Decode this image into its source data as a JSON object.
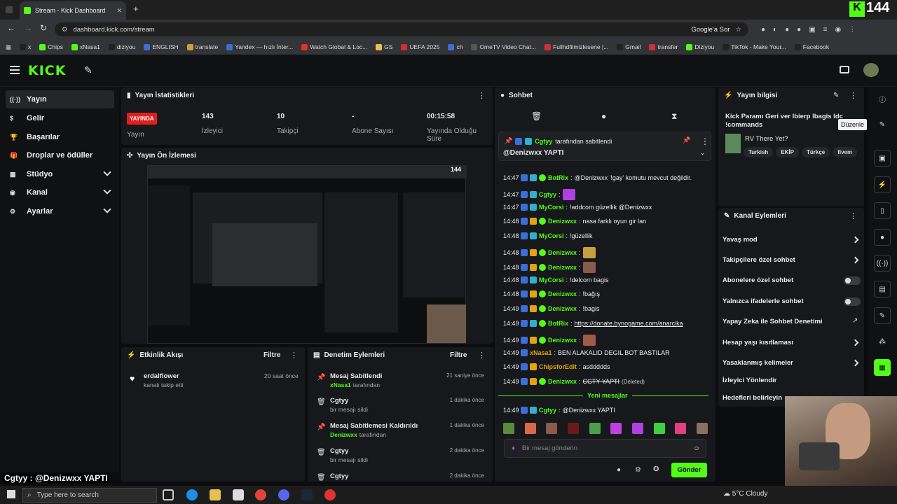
{
  "browser": {
    "tab_title": "Stream - Kick Dashboard",
    "url": "dashboard.kick.com/stream",
    "google_lens": "Google'a Sor",
    "bookmarks": [
      "x",
      "Chips",
      "xNasa1",
      "diziyou",
      "ENGLISH",
      "translate",
      "Yandex — hızlı İnter...",
      "Watch Global & Loc...",
      "GS",
      "UEFA 2025",
      "ch",
      "OmeTV Video Chat...",
      "Fullhdfilmizlesene |...",
      "Gmail",
      "transfer",
      "Diziyou",
      "TikTok - Make Your...",
      "Facebook"
    ]
  },
  "overlay": {
    "corner_logo": "144",
    "bottom_text": "Cgtyy : @Denizwxx YAPTI"
  },
  "kick": {
    "logo": "KICK"
  },
  "sidebar": {
    "items": [
      {
        "label": "Yayın",
        "icon": "broadcast-icon"
      },
      {
        "label": "Gelir",
        "icon": "money-icon"
      },
      {
        "label": "Başarılar",
        "icon": "trophy-icon"
      },
      {
        "label": "Droplar ve ödüller",
        "icon": "gift-icon"
      },
      {
        "label": "Stüdyo",
        "icon": "studio-icon"
      },
      {
        "label": "Kanal",
        "icon": "channel-icon"
      },
      {
        "label": "Ayarlar",
        "icon": "gear-icon"
      }
    ]
  },
  "stats": {
    "title": "Yayın İstatistikleri",
    "live": "YAYINDA",
    "live_label": "Yayın",
    "viewers": "143",
    "viewers_label": "İzleyici",
    "followers": "10",
    "followers_label": "Takipçi",
    "subs": "-",
    "subs_label": "Abone Sayısı",
    "uptime": "00:15:58",
    "uptime_label": "Yayında Olduğu Süre"
  },
  "preview": {
    "title": "Yayın Ön İzlemesi"
  },
  "activity": {
    "title": "Etkinlik Akışı",
    "filter": "Filtre",
    "items": [
      {
        "user": "erdalflower",
        "text": "kanalı takip etti",
        "time": "20 saat önce"
      }
    ]
  },
  "moderation": {
    "title": "Denetim Eylemleri",
    "filter": "Filtre",
    "items": [
      {
        "title": "Mesaj Sabitlendi",
        "sub": "xNasa1",
        "suffix": "tarafından",
        "time": "21 saniye önce"
      },
      {
        "title": "Cgtyy",
        "sub": "",
        "suffix": "bir mesajı sildi",
        "time": "1 dakika önce"
      },
      {
        "title": "Mesaj Sabitlemesi Kaldırıldı",
        "sub": "Denizwxx",
        "suffix": "tarafından",
        "time": "1 dakika önce"
      },
      {
        "title": "Cgtyy",
        "sub": "",
        "suffix": "bir mesajı sildi",
        "time": "2 dakika önce"
      },
      {
        "title": "Cgtyy",
        "sub": "",
        "suffix": "",
        "time": "2 dakika önce"
      }
    ]
  },
  "chat": {
    "title": "Sohbet",
    "pinned_by": "Cgtyy",
    "pinned_suffix": "tarafından sabitlendi",
    "pinned_text": "@Denizwxx YAPTI",
    "messages": [
      {
        "t": "14:47",
        "u": "BotRix",
        "m": "@Denizwxx '!gay' komutu mevcut değildir.",
        "c": "#53fc18"
      },
      {
        "t": "14:47",
        "u": "Cgtyy",
        "m": "",
        "c": "#53fc18"
      },
      {
        "t": "14:47",
        "u": "MyCorsi",
        "m": "!addcom güzellik @Denizwxx",
        "c": "#53fc18"
      },
      {
        "t": "14:48",
        "u": "Denizwxx",
        "m": "nasa farklı oyun gir lan",
        "c": "#53fc18"
      },
      {
        "t": "14:48",
        "u": "MyCorsi",
        "m": "!güzellik",
        "c": "#53fc18"
      },
      {
        "t": "14:48",
        "u": "Denizwxx",
        "m": "",
        "c": "#53fc18"
      },
      {
        "t": "14:48",
        "u": "Denizwxx",
        "m": "",
        "c": "#53fc18"
      },
      {
        "t": "14:48",
        "u": "MyCorsi",
        "m": "!delcom bagis",
        "c": "#53fc18"
      },
      {
        "t": "14:48",
        "u": "Denizwxx",
        "m": "!bağış",
        "c": "#53fc18"
      },
      {
        "t": "14:49",
        "u": "Denizwxx",
        "m": "!bagis",
        "c": "#53fc18"
      },
      {
        "t": "14:49",
        "u": "BotRix",
        "m": "https://donate.bynogame.com/anarcika",
        "c": "#53fc18"
      },
      {
        "t": "14:49",
        "u": "Denizwxx",
        "m": "",
        "c": "#53fc18"
      },
      {
        "t": "14:49",
        "u": "xNasa1",
        "m": "BEN ALAKALID DEGIL BOT BASTILAR",
        "c": "#e0a511"
      },
      {
        "t": "14:49",
        "u": "ChipsforEdit",
        "m": "asddddds",
        "c": "#e0a511"
      },
      {
        "t": "14:49",
        "u": "Denizwxx",
        "m": "CGTY YAPTI",
        "c": "#53fc18"
      }
    ],
    "deleted": "(Deleted)",
    "new_messages": "Yeni mesajlar",
    "last": {
      "t": "14:49",
      "u": "Cgtyy",
      "m": "@Denizwxx YAPTI"
    },
    "placeholder": "Bir mesaj gönderin",
    "send": "Gönder"
  },
  "stream_info": {
    "title": "Yayın bilgisi",
    "stream_title": "Kick Paramı Geri ver lbierp lbagis ldc !commands",
    "category": "RV There Yet?",
    "tags": [
      "Turkish",
      "EKİP",
      "Türkçe",
      "fivem"
    ],
    "tooltip": "Düzenle"
  },
  "channel_actions": {
    "title": "Kanal Eylemleri",
    "items": [
      "Yavaş mod",
      "Takipçilere özel sohbet",
      "Abonelere özel sohbet",
      "Yalnızca ifadelerle sohbet",
      "Yapay Zeka ile Sohbet Denetimi",
      "Hesap yaşı kısıtlaması",
      "Yasaklanmış kelimeler",
      "İzleyici Yönlendir",
      "Hedefleri belirleyin"
    ]
  },
  "taskbar": {
    "search": "Type here to search",
    "weather": "5°C Cloudy"
  }
}
